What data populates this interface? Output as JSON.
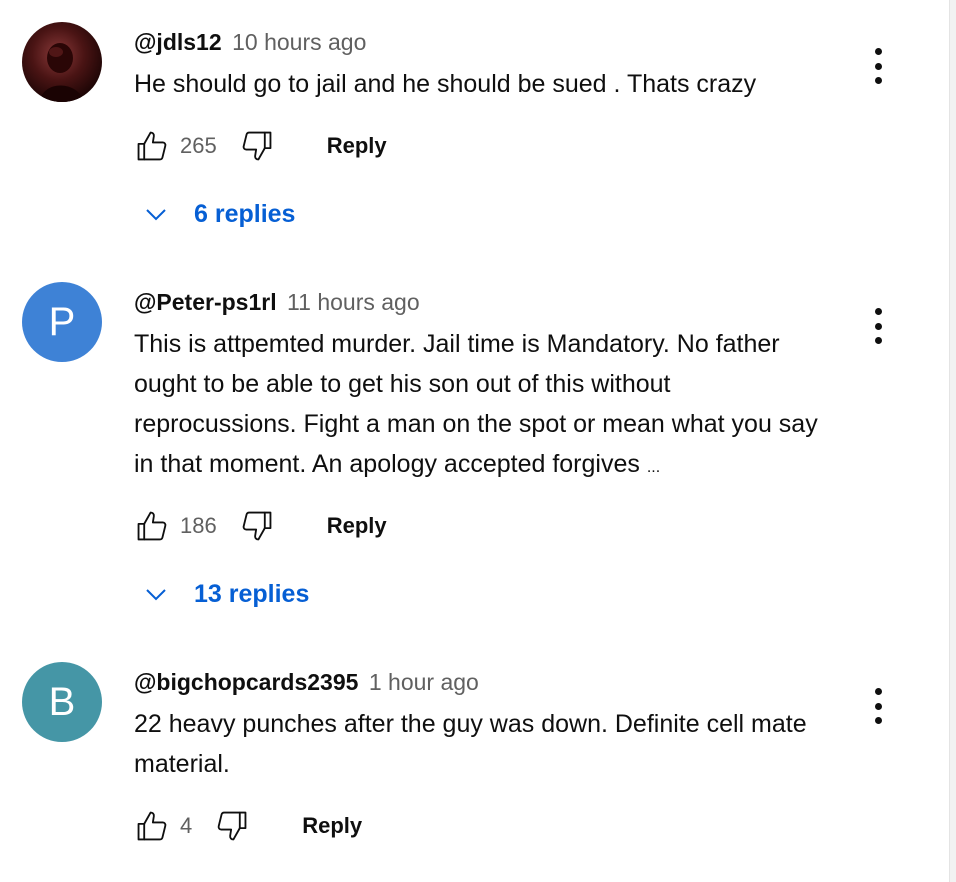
{
  "comments": [
    {
      "author": "@jdls12",
      "time": "10 hours ago",
      "text": "He should go to jail and he should be sued . Thats crazy",
      "likes": "265",
      "reply_label": "Reply",
      "replies_label": "6 replies",
      "avatar_letter": "",
      "avatar_color": "#3a0c0c"
    },
    {
      "author": "@Peter-ps1rl",
      "time": "11 hours ago",
      "text": "This is attpemted murder. Jail time is Mandatory. No father ought to be able to get his son out of this without reprocussions. Fight a man on the spot or mean what you say in that moment. An apology accepted forgives",
      "truncation": "...",
      "likes": "186",
      "reply_label": "Reply",
      "replies_label": "13 replies",
      "avatar_letter": "P",
      "avatar_color": "#3e82d6"
    },
    {
      "author": "@bigchopcards2395",
      "time": "1 hour ago",
      "text": "22 heavy punches after the guy was down. Definite cell mate material.",
      "likes": "4",
      "reply_label": "Reply",
      "avatar_letter": "B",
      "avatar_color": "#4596a6"
    }
  ],
  "icons": {
    "like": "thumbs-up-icon",
    "dislike": "thumbs-down-icon",
    "expand": "chevron-down-icon",
    "menu": "more-vert-icon"
  },
  "colors": {
    "link_blue": "#065fd4",
    "meta_gray": "#606060"
  }
}
